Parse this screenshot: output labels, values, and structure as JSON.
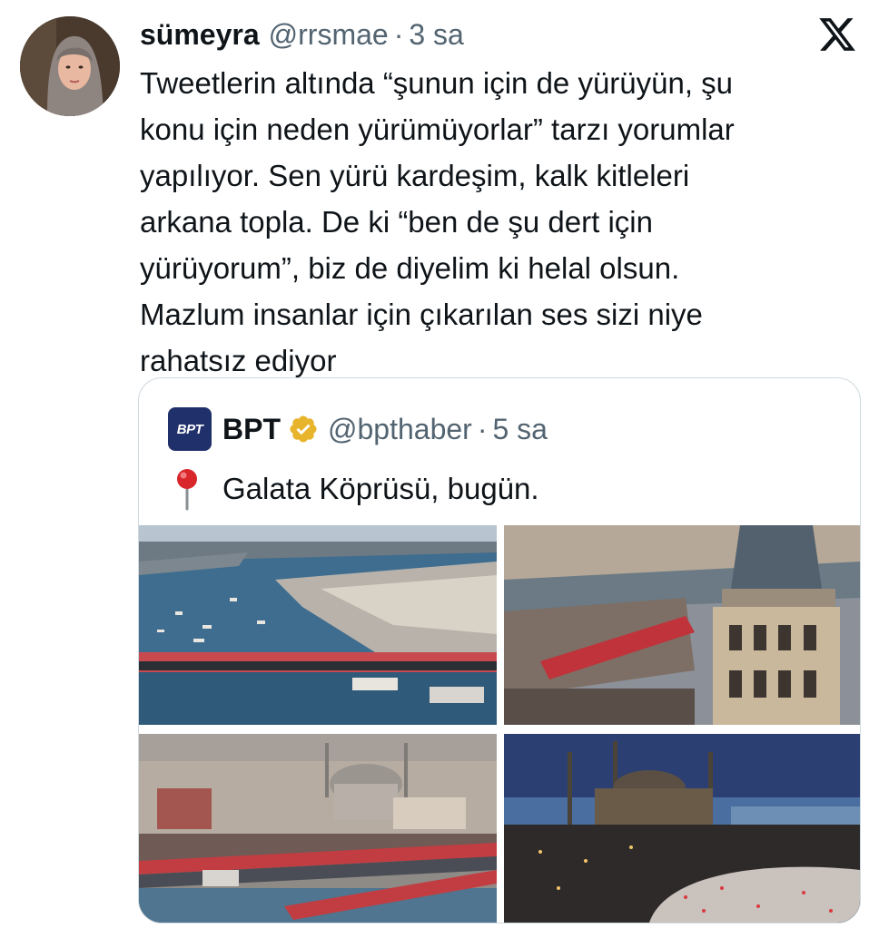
{
  "tweet": {
    "display_name": "sümeyra",
    "handle": "@rrsmae",
    "separator": "·",
    "time": "3 sa",
    "text_lines": [
      "Tweetlerin altında “şunun için de yürüyün, şu",
      "konu için neden yürümüyorlar” tarzı yorumlar",
      "yapılıyor. Sen yürü kardeşim, kalk kitleleri",
      "arkana topla. De ki “ben de şu dert için",
      "yürüyorum”, biz de diyelim ki helal olsun.",
      "Mazlum insanlar için çıkarılan ses sizi niye",
      "rahatsız ediyor"
    ]
  },
  "platform_icon": "x-logo-icon",
  "quote": {
    "logo_text": "BPT",
    "display_name": "BPT",
    "verified_icon": "gold-verified-badge-icon",
    "handle": "@bpthaber",
    "separator": "·",
    "time": "5 sa",
    "pin_icon": "round-pushpin-icon",
    "text": "Galata Köprüsü, bugün.",
    "photos": [
      "aerial-galata-bridge-golden-horn",
      "galata-tower-with-crowd-on-bridge",
      "new-mosque-and-crowded-bridge",
      "hagia-sophia-night-crowd"
    ]
  },
  "colors": {
    "text_primary": "#0f1419",
    "text_secondary": "#536471",
    "border": "#cfd9de",
    "verified_gold": "#e8b42c",
    "logo_navy": "#20306b",
    "pin_red": "#d9262b"
  }
}
